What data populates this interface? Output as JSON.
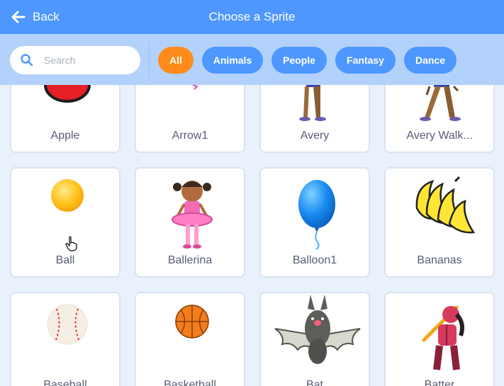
{
  "header": {
    "back_label": "Back",
    "title": "Choose a Sprite"
  },
  "search": {
    "placeholder": "Search"
  },
  "tags": [
    {
      "label": "All",
      "active": true
    },
    {
      "label": "Animals"
    },
    {
      "label": "People"
    },
    {
      "label": "Fantasy"
    },
    {
      "label": "Dance"
    }
  ],
  "colors": {
    "header_blue": "#4d97ff",
    "filter_bg": "#b3d2fb",
    "active_tag": "#ff8c1a"
  },
  "sprites": [
    {
      "name": "Apple"
    },
    {
      "name": "Arrow1"
    },
    {
      "name": "Avery"
    },
    {
      "name": "Avery Walk..."
    },
    {
      "name": "Ball"
    },
    {
      "name": "Ballerina"
    },
    {
      "name": "Balloon1"
    },
    {
      "name": "Bananas"
    },
    {
      "name": "Baseball"
    },
    {
      "name": "Basketball"
    },
    {
      "name": "Bat"
    },
    {
      "name": "Batter"
    }
  ]
}
